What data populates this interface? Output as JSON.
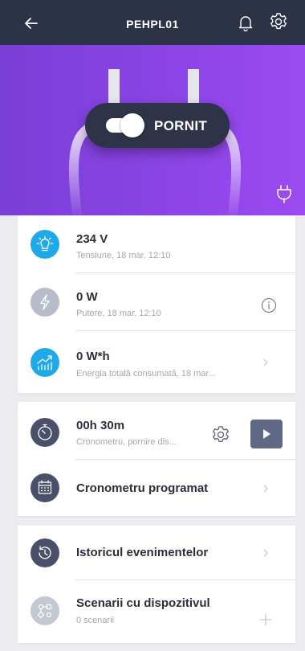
{
  "header": {
    "title": "PEHPL01",
    "back_icon": "back-arrow-icon",
    "bell_icon": "bell-icon",
    "settings_icon": "gear-icon"
  },
  "hero": {
    "switch_state_label": "PORNIT",
    "switch_on": true,
    "plug_icon": "plug-icon",
    "gradient_start": "#7a3fd6",
    "gradient_end": "#9c4af2"
  },
  "measurements": [
    {
      "value": "234 V",
      "caption": "Tensiune, 18 mar. 12:10",
      "icon": "bulb-icon",
      "action": "none"
    },
    {
      "value": "0 W",
      "caption": "Putere, 18 mar. 12:10",
      "icon": "lightning-icon",
      "action": "info-icon"
    },
    {
      "value": "0 W*h",
      "caption": "Energia totală consumată, 18 mar...",
      "icon": "energy-chart-icon",
      "action": "chevron-right-icon"
    }
  ],
  "timer": {
    "value": "00h 30m",
    "caption": "Cronometru, pornire dis...",
    "icon": "stopwatch-icon",
    "settings_icon": "gear-icon",
    "play_icon": "play-icon"
  },
  "scheduled_timer": {
    "label": "Cronometru programat",
    "icon": "calendar-icon"
  },
  "history": {
    "label": "Istoricul evenimentelor",
    "icon": "history-icon"
  },
  "scenarios": {
    "label": "Scenarii cu dispozitivul",
    "caption": "0 scenarii",
    "icon": "scenario-icon",
    "action": "plus-icon"
  },
  "colors": {
    "header_bg": "#2d3346",
    "accent_blue": "#20a9e8",
    "slate": "#4a5069",
    "play_button": "#5f6884"
  }
}
